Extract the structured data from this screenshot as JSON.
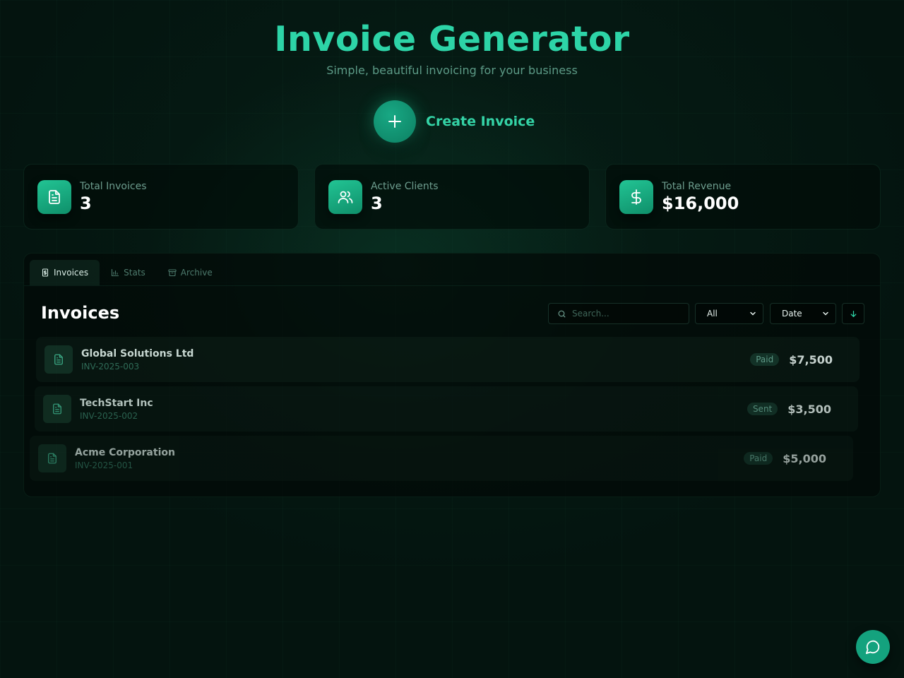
{
  "header": {
    "title": "Invoice Generator",
    "subtitle": "Simple, beautiful invoicing for your business"
  },
  "create": {
    "label": "Create Invoice",
    "icon": "plus-icon"
  },
  "stats": [
    {
      "label": "Total Invoices",
      "value": "3",
      "icon": "document-icon"
    },
    {
      "label": "Active Clients",
      "value": "3",
      "icon": "users-icon"
    },
    {
      "label": "Total Revenue",
      "value": "$16,000",
      "icon": "dollar-icon"
    }
  ],
  "tabs": [
    {
      "label": "Invoices",
      "icon": "invoice-icon",
      "active": true
    },
    {
      "label": "Stats",
      "icon": "bar-chart-icon",
      "active": false
    },
    {
      "label": "Archive",
      "icon": "archive-icon",
      "active": false
    }
  ],
  "list": {
    "title": "Invoices",
    "search_placeholder": "Search...",
    "status_filter": "All",
    "sort_field": "Date",
    "sort_direction_icon": "arrow-down-icon"
  },
  "invoices": [
    {
      "client": "Global Solutions Ltd",
      "number": "INV-2025-003",
      "status": "Paid",
      "amount": "$7,500"
    },
    {
      "client": "TechStart Inc",
      "number": "INV-2025-002",
      "status": "Sent",
      "amount": "$3,500"
    },
    {
      "client": "Acme Corporation",
      "number": "INV-2025-001",
      "status": "Paid",
      "amount": "$5,000"
    }
  ],
  "colors": {
    "accent": "#2dd4a7",
    "background": "#04140f",
    "button": "#14a27e"
  },
  "chat": {
    "icon": "chat-bubble-icon"
  }
}
